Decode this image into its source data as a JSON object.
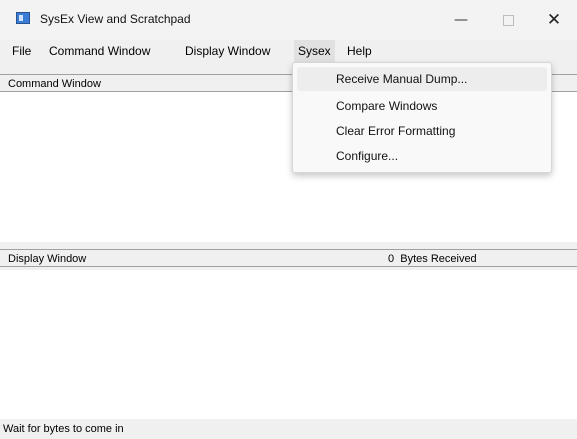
{
  "window": {
    "title": "SysEx View and Scratchpad",
    "minimize_glyph": "—",
    "close_glyph": "✕",
    "icon": "app-window-icon"
  },
  "menubar": {
    "items": [
      "File",
      "Command Window",
      "Display Window",
      "Sysex",
      "Help"
    ],
    "active": "Sysex"
  },
  "sysex_menu": {
    "items": [
      "Receive Manual Dump...",
      "Compare Windows",
      "Clear Error Formatting",
      "Configure..."
    ],
    "highlighted": "Receive Manual Dump..."
  },
  "command_pane": {
    "label": "Command Window"
  },
  "display_pane": {
    "label": "Display Window",
    "bytes_count": "0",
    "bytes_label": "Bytes Received"
  },
  "status": {
    "text": "Wait for bytes to come in"
  },
  "colors": {
    "chrome": "#f0f0f0",
    "pane_bg": "#ffffff",
    "menu_hover": "#ededed",
    "icon_blue": "#3a7bd5"
  }
}
